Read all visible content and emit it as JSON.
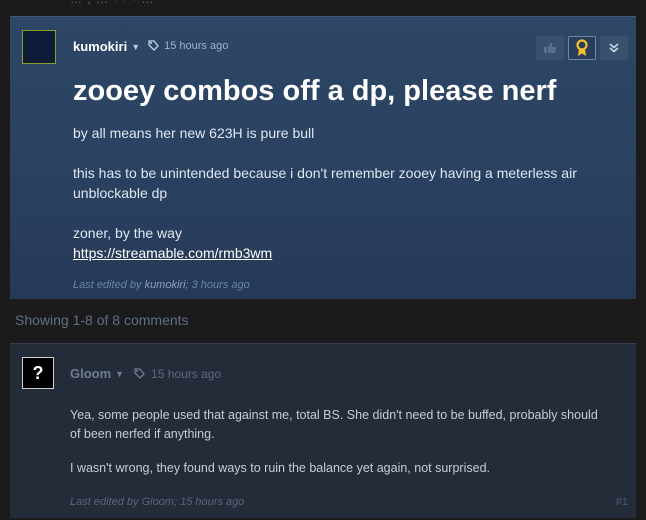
{
  "top_cut_text": "… ; … · · · …",
  "op": {
    "author": "kumokiri",
    "timestamp": "15 hours ago",
    "title": "zooey combos off a dp, please nerf",
    "body": [
      "by all means her new 623H is pure bull",
      "this has to be unintended because i don't remember zooey having a meterless air unblockable dp",
      "zoner, by the way"
    ],
    "link": "https://streamable.com/rmb3wm",
    "edited_prefix": "Last edited by ",
    "edited_user": "kumokiri",
    "edited_suffix": "; 3 hours ago",
    "tool_icons": [
      "thumb-icon",
      "award-icon",
      "chevrons-down-icon"
    ],
    "accent_color": "#f2c12e"
  },
  "comments_count": "Showing 1-8 of 8 comments",
  "comment": {
    "avatar_glyph": "?",
    "author": "Gloom",
    "timestamp": "15 hours ago",
    "body": [
      "Yea, some people used that against me, total BS. She didn't need to be buffed, probably should of been nerfed if anything.",
      "I wasn't wrong, they found ways to ruin the balance yet again, not surprised."
    ],
    "edited_prefix": "Last edited by ",
    "edited_user": "Gloom",
    "edited_suffix": "; 15 hours ago",
    "number": "#1"
  }
}
